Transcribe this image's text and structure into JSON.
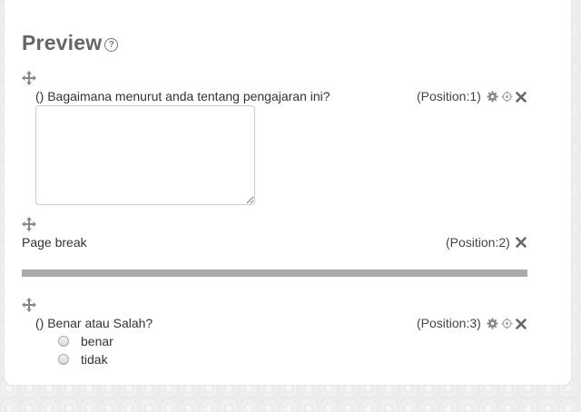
{
  "preview": {
    "title": "Preview",
    "help_glyph": "?"
  },
  "questions": [
    {
      "text": "() Bagaimana menurut anda tentang pengajaran ini?",
      "position": "(Position:1)"
    },
    {
      "label": "Page break",
      "position": "(Position:2)"
    },
    {
      "text": "() Benar atau Salah?",
      "position": "(Position:3)",
      "options": [
        "benar",
        "tidak"
      ]
    }
  ],
  "icons": [
    "move-icon",
    "gear-icon",
    "settings-icon",
    "delete-icon",
    "help-icon"
  ]
}
